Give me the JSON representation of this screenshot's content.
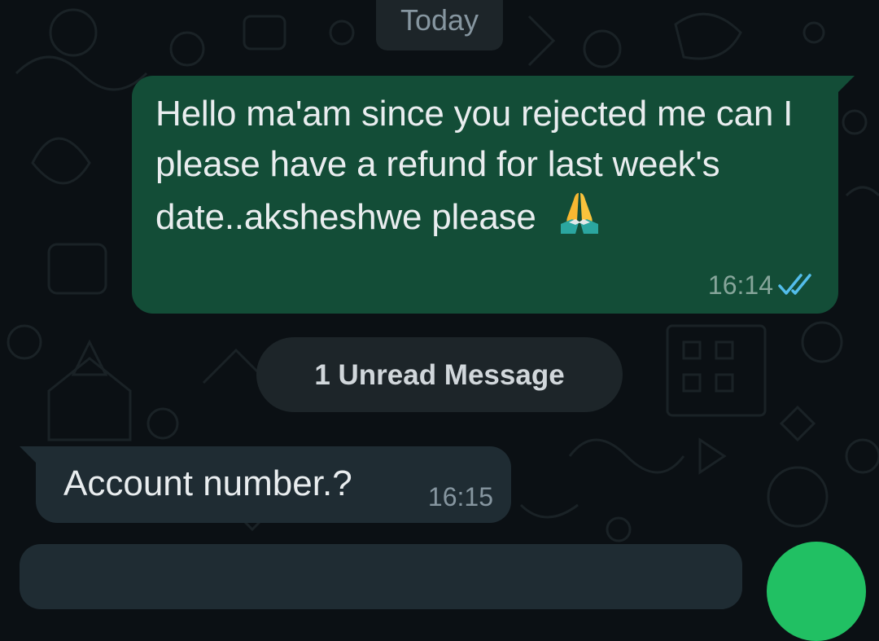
{
  "date_separator": "Today",
  "messages": [
    {
      "direction": "outgoing",
      "text": "Hello ma'am since you rejected me can I please have a refund for last week's date..aksheshwe please",
      "emoji_icon": "folded-hands-icon",
      "time": "16:14",
      "status_icon": "double-check-read-icon"
    },
    {
      "direction": "incoming",
      "text": "Account number.?",
      "time": "16:15"
    }
  ],
  "unread_banner": "1 Unread Message",
  "colors": {
    "background": "#0b1014",
    "outgoing_bubble": "#134d37",
    "incoming_bubble": "#1f2c33",
    "chip": "#1d2529",
    "read_tick": "#53bdeb",
    "fab_green": "#21c063"
  }
}
